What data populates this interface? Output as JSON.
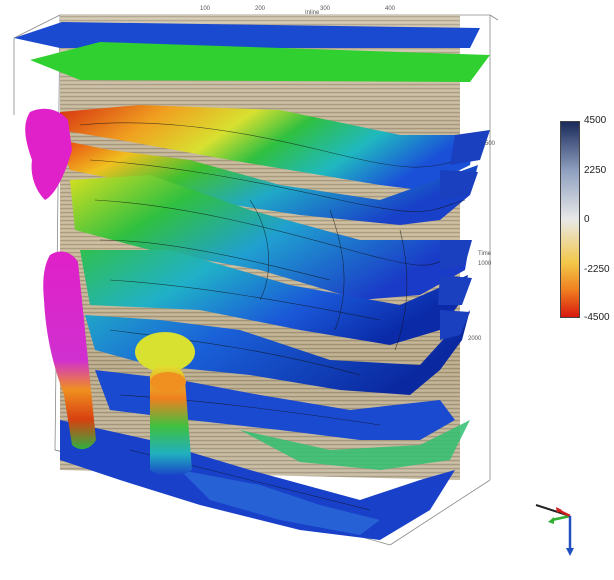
{
  "figure": {
    "colorbar": {
      "labels": [
        "4500",
        "2250",
        "0",
        "-2250",
        "-4500"
      ],
      "colors": [
        "#1a2a5a",
        "#8fa0c0",
        "#e8e8e8",
        "#f2c84a",
        "#d81810"
      ]
    },
    "axis_ticks": {
      "top": [
        "100",
        "200",
        "300",
        "400",
        "Inline"
      ],
      "right": [
        "500",
        "Time",
        "1000",
        "2000"
      ]
    },
    "horizon_colors": {
      "high": "#d62a10",
      "mid": "#f4a020",
      "yellow": "#e8e82a",
      "green": "#30c030",
      "cyan": "#20b0c0",
      "blue": "#1a4ad0",
      "deep": "#0a2aa0",
      "salt": "#e020c8"
    },
    "orientation_axes": [
      "x-axis-arrow",
      "y-axis-arrow",
      "z-axis-arrow"
    ]
  }
}
